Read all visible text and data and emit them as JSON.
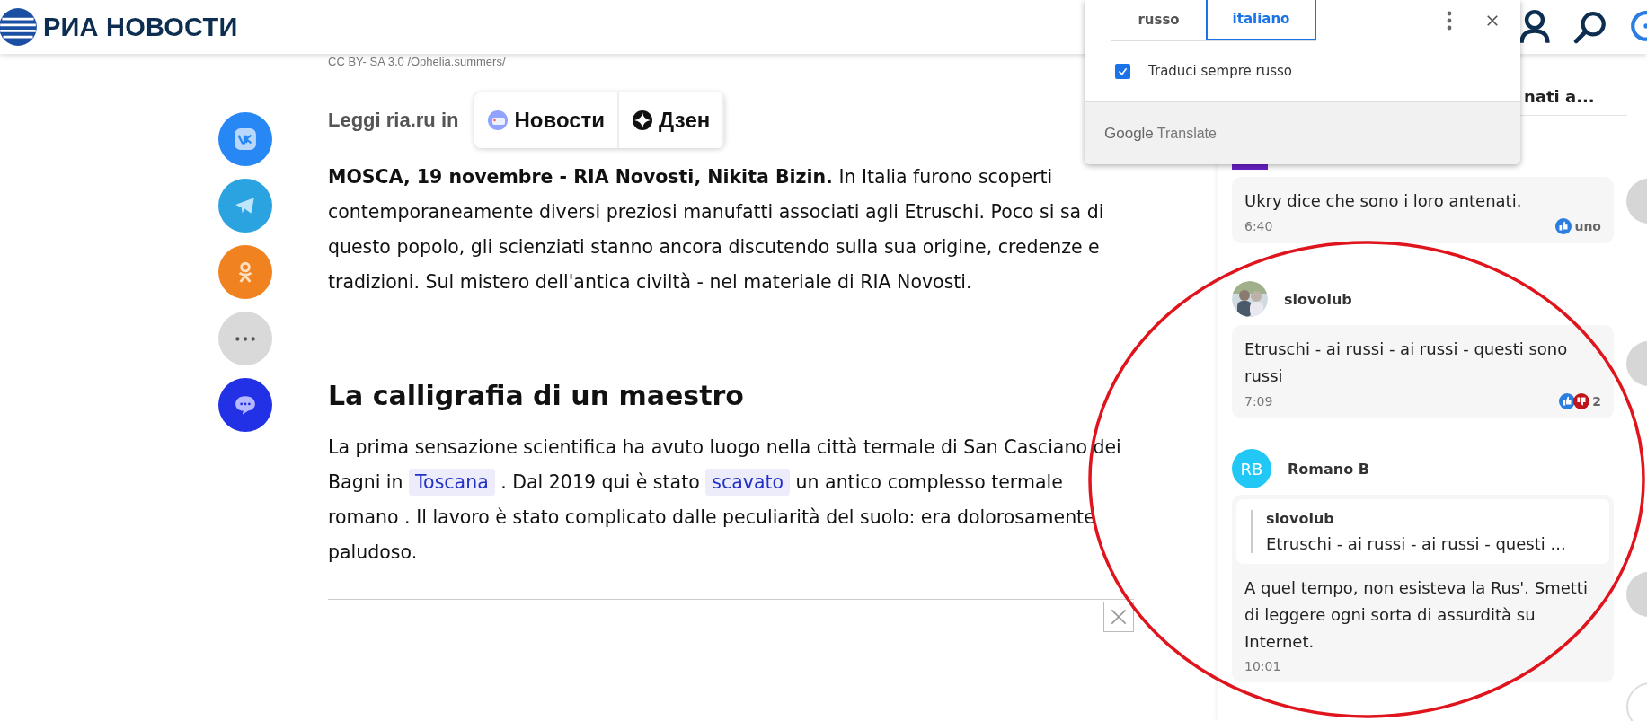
{
  "header": {
    "logo": "РИА НОВОСТИ"
  },
  "photo_credit": "CC BY- SA 3.0 /Ophelia.summers/",
  "share_buttons": [
    {
      "kind": "vk"
    },
    {
      "kind": "telegram"
    },
    {
      "kind": "ok"
    },
    {
      "kind": "more"
    },
    {
      "kind": "comments"
    }
  ],
  "read_in": {
    "label": "Leggi ria.ru in",
    "services": [
      {
        "kind": "novosti",
        "label": "Новости"
      },
      {
        "kind": "dzen",
        "label": "Дзен"
      }
    ]
  },
  "article": {
    "lead": "**MOSCA, 19 novembre - RIA Novosti, Nikita Bizin.** In Italia furono scoperti contemporaneamente diversi preziosi manufatti associati agli Etruschi. Poco si sa di questo popolo, gli scienziati stanno ancora discutendo sulla sua origine, credenze e tradizioni. Sul mistero dell'antica civiltà - nel materiale di RIA Novosti.",
    "heading": "La calligrafia di un maestro",
    "paragraph": [
      {
        "kind": "text",
        "text": "La prima sensazione scientifica ha avuto luogo nella città termale di San Casciano dei Bagni in "
      },
      {
        "kind": "link",
        "text": "Toscana"
      },
      {
        "kind": "text",
        "text": " . Dal 2019 qui è stato "
      },
      {
        "kind": "link",
        "text": "scavato"
      },
      {
        "kind": "text",
        "text": " un antico complesso termale romano . Il lavoro è stato complicato dalle peculiarità del suolo: era dolorosamente paludoso."
      }
    ]
  },
  "translate_popup": {
    "tabs": [
      {
        "label": "russo",
        "selected": false
      },
      {
        "label": "italiano",
        "selected": true
      }
    ],
    "always_translate": {
      "label": "Traduci sempre russo",
      "checked": true
    },
    "footer": {
      "brand": "Google",
      "product": "Translate"
    }
  },
  "comments_panel": {
    "header_fragment": "nati a...",
    "comments": [
      {
        "avatar": {
          "kind": "hidden"
        },
        "text": "Ukry dice che sono i loro antenati.",
        "time": "6:40",
        "liked": true,
        "disliked": false,
        "count": "uno"
      },
      {
        "author": "slovolub",
        "text": "Etruschi - ai russi - ai russi - questi sono russi",
        "time": "7:09",
        "liked": true,
        "disliked": true,
        "count": "2"
      },
      {
        "avatar": {
          "kind": "initials",
          "initials": "RB"
        },
        "author": "Romano B",
        "quote": {
          "author": "slovolub",
          "text": "Etruschi - ai russi - ai russi - questi ..."
        },
        "text": "A quel tempo, non esisteva la Rus'. Smetti di leggere ogni sorta di assurdità su Internet.",
        "time": "10:01",
        "liked": false,
        "disliked": false
      }
    ]
  }
}
